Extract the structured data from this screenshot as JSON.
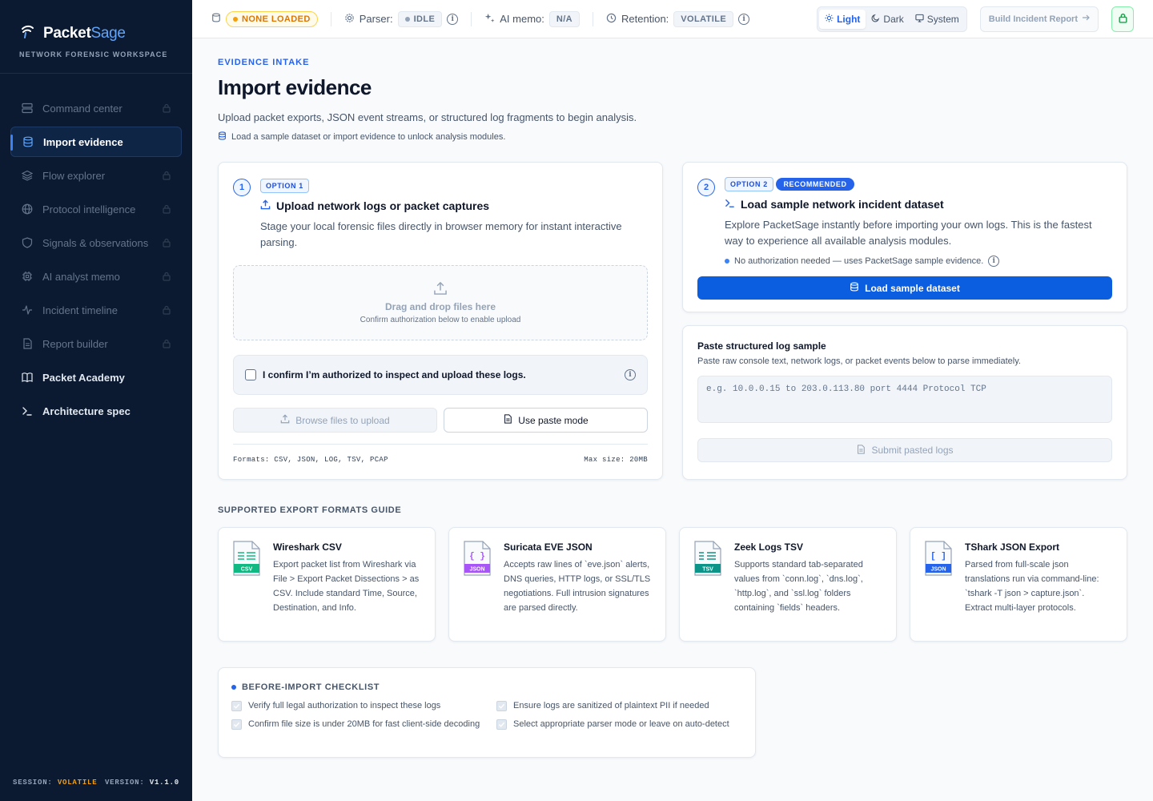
{
  "brand": {
    "name_a": "Packet",
    "name_b": "Sage",
    "subtitle": "NETWORK FORENSIC WORKSPACE"
  },
  "nav": [
    {
      "label": "Command center",
      "icon": "server-icon",
      "locked": true
    },
    {
      "label": "Import evidence",
      "icon": "database-icon",
      "active": true
    },
    {
      "label": "Flow explorer",
      "icon": "layers-icon",
      "locked": true
    },
    {
      "label": "Protocol intelligence",
      "icon": "globe-icon",
      "locked": true
    },
    {
      "label": "Signals & observations",
      "icon": "shield-icon",
      "locked": true
    },
    {
      "label": "AI analyst memo",
      "icon": "cpu-icon",
      "locked": true
    },
    {
      "label": "Incident timeline",
      "icon": "activity-icon",
      "locked": true
    },
    {
      "label": "Report builder",
      "icon": "file-icon",
      "locked": true
    },
    {
      "label": "Packet Academy",
      "icon": "book-icon"
    },
    {
      "label": "Architecture spec",
      "icon": "terminal-icon"
    }
  ],
  "session": {
    "label": "SESSION:",
    "value": "VOLATILE",
    "version_label": "VERSION:",
    "version": "V1.1.0"
  },
  "topbar": {
    "dataset_status": "NONE LOADED",
    "parser_label": "Parser:",
    "parser_value": "IDLE",
    "ai_label": "AI memo:",
    "ai_value": "N/A",
    "retention_label": "Retention:",
    "retention_value": "VOLATILE",
    "theme": {
      "light": "Light",
      "dark": "Dark",
      "system": "System",
      "selected": "Light"
    },
    "build_report": "Build Incident Report"
  },
  "header": {
    "eyebrow": "EVIDENCE INTAKE",
    "title": "Import evidence",
    "description": "Upload packet exports, JSON event streams, or structured log fragments to begin analysis.",
    "hint": "Load a sample dataset or import evidence to unlock analysis modules."
  },
  "option1": {
    "number": "1",
    "badge": "OPTION 1",
    "title": "Upload network logs or packet captures",
    "description": "Stage your local forensic files directly in browser memory for instant interactive parsing.",
    "drop_title": "Drag and drop files here",
    "drop_sub": "Confirm authorization below to enable upload",
    "auth_label": "I confirm I’m authorized to inspect and upload these logs.",
    "browse": "Browse files to upload",
    "paste_mode": "Use paste mode",
    "formats": "Formats: CSV, JSON, LOG, TSV, PCAP",
    "max_size": "Max size: 20MB"
  },
  "option2": {
    "number": "2",
    "badge": "OPTION 2",
    "recommended": "RECOMMENDED",
    "title": "Load sample network incident dataset",
    "description": "Explore PacketSage instantly before importing your own logs. This is the fastest way to experience all available analysis modules.",
    "note": "No authorization needed — uses PacketSage sample evidence.",
    "button": "Load sample dataset"
  },
  "paste": {
    "title": "Paste structured log sample",
    "subtitle": "Paste raw console text, network logs, or packet events below to parse immediately.",
    "placeholder": "e.g. 10.0.0.15 to 203.0.113.80 port 4444 Protocol TCP",
    "submit": "Submit pasted logs"
  },
  "formats_guide": {
    "heading": "SUPPORTED EXPORT FORMATS GUIDE",
    "items": [
      {
        "tag": "CSV",
        "tag_color": "#10b981",
        "title": "Wireshark CSV",
        "description": "Export packet list from Wireshark via File > Export Packet Dissections > as CSV. Include standard Time, Source, Destination, and Info."
      },
      {
        "tag": "JSON",
        "tag_color": "#a855f7",
        "title": "Suricata EVE JSON",
        "description": "Accepts raw lines of `eve.json` alerts, DNS queries, HTTP logs, or SSL/TLS negotiations. Full intrusion signatures are parsed directly."
      },
      {
        "tag": "TSV",
        "tag_color": "#0d9488",
        "title": "Zeek Logs TSV",
        "description": "Supports standard tab-separated values from `conn.log`, `dns.log`, `http.log`, and `ssl.log` folders containing `fields` headers."
      },
      {
        "tag": "JSON",
        "tag_color": "#2563eb",
        "title": "TShark JSON Export",
        "description": "Parsed from full-scale json translations run via command-line: `tshark -T json > capture.json`. Extract multi-layer protocols."
      }
    ]
  },
  "checklist": {
    "title": "BEFORE-IMPORT CHECKLIST",
    "items": [
      "Verify full legal authorization to inspect these logs",
      "Ensure logs are sanitized of plaintext PII if needed",
      "Confirm file size is under 20MB for fast client-side decoding",
      "Select appropriate parser mode or leave on auto-detect"
    ]
  },
  "colors": {
    "accent": "#2563eb",
    "sidebar": "#0b1a30",
    "warning": "#f59e0b"
  }
}
